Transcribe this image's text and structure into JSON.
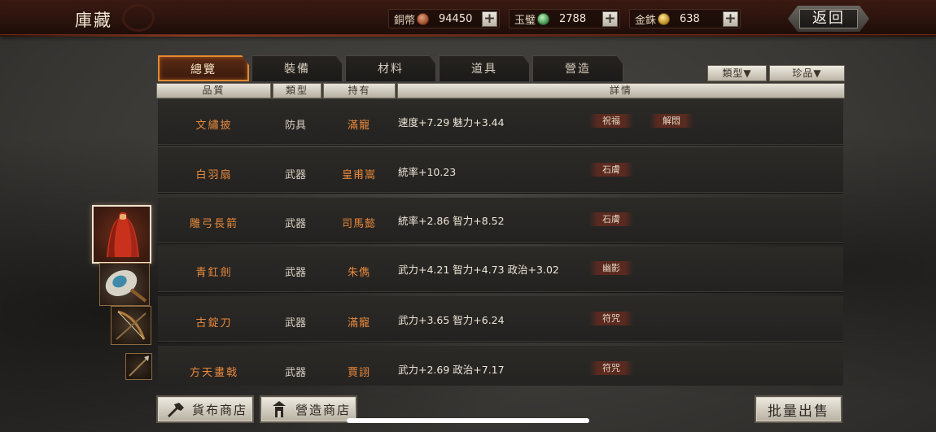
{
  "app": {
    "title": "庫藏"
  },
  "currencies": [
    {
      "label": "銅幣",
      "icon": "copper-coin-icon",
      "value": "94450",
      "plus": "+"
    },
    {
      "label": "玉璧",
      "icon": "jade-disc-icon",
      "value": "2788",
      "plus": "+"
    },
    {
      "label": "金銖",
      "icon": "gold-coin-icon",
      "value": "638",
      "plus": "+"
    }
  ],
  "back_label": "返回",
  "tabs": [
    {
      "label": "總覽",
      "active": true
    },
    {
      "label": "裝備",
      "active": false
    },
    {
      "label": "材料",
      "active": false
    },
    {
      "label": "道具",
      "active": false
    },
    {
      "label": "營造",
      "active": false
    }
  ],
  "filters": {
    "type": "類型▼",
    "rare": "珍品▼"
  },
  "columns": {
    "quality": "品質",
    "type": "類型",
    "owner": "持有",
    "detail": "詳情"
  },
  "items": [
    {
      "name": "文繡披",
      "type": "防具",
      "owner": "滿寵",
      "detail": "速度+7.29  魅力+3.44",
      "badges": [
        "祝福",
        "解悶"
      ]
    },
    {
      "name": "白羽扇",
      "type": "武器",
      "owner": "皇甫嵩",
      "detail": "統率+10.23",
      "badges": [
        "石膚"
      ]
    },
    {
      "name": "雕弓長箭",
      "type": "武器",
      "owner": "司馬懿",
      "detail": "統率+2.86  智力+8.52",
      "badges": [
        "石膚"
      ]
    },
    {
      "name": "青釭劍",
      "type": "武器",
      "owner": "朱儁",
      "detail": "武力+4.21  智力+4.73  政治+3.02",
      "badges": [
        "幽影"
      ]
    },
    {
      "name": "古錠刀",
      "type": "武器",
      "owner": "滿寵",
      "detail": "武力+3.65  智力+6.24",
      "badges": [
        "符咒"
      ]
    },
    {
      "name": "方天畫戟",
      "type": "武器",
      "owner": "賈詡",
      "detail": "武力+2.69  政治+7.17",
      "badges": [
        "符咒"
      ]
    }
  ],
  "bottom": {
    "shop_cloth": "貨布商店",
    "shop_build": "營造商店",
    "batch_sell": "批量出售"
  },
  "colors": {
    "accent": "#e8893c",
    "tab_active_border": "#e08a32"
  }
}
